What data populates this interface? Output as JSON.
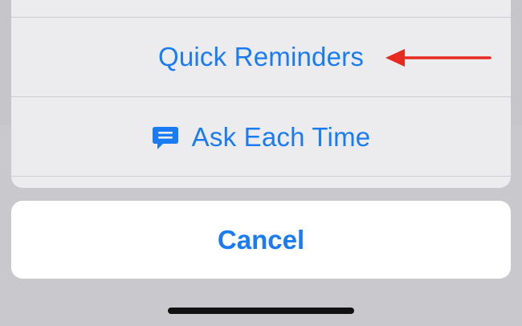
{
  "action_sheet": {
    "options": [
      {
        "label": "Quick Reminders",
        "icon": ""
      },
      {
        "label": "Ask Each Time",
        "icon": "message-icon"
      }
    ],
    "cancel_label": "Cancel"
  },
  "colors": {
    "accent": "#1a7cf5",
    "annotation_arrow": "#e8291f",
    "sheet_background": "#ececef",
    "cancel_background": "#ffffff",
    "backdrop": "#c6c6ca"
  }
}
